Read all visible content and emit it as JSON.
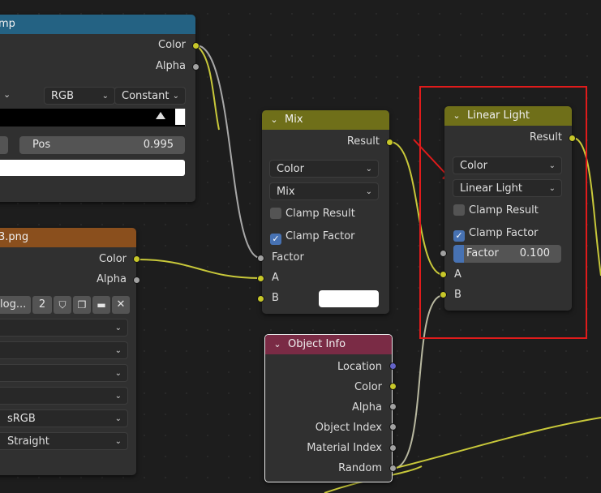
{
  "colorramp_node": {
    "title_fragment": "mp",
    "outputs": [
      "Color",
      "Alpha"
    ],
    "color_mode": "RGB",
    "interpolation": "Constant",
    "pos_label": "Pos",
    "pos_value": "0.995"
  },
  "image_node": {
    "title_fragment": "3.png",
    "outputs": [
      "Color",
      "Alpha"
    ],
    "image_name_fragment": "log...",
    "user_count": "2",
    "color_space": "sRGB",
    "alpha_mode": "Straight"
  },
  "mix_node": {
    "title": "Mix",
    "output": "Result",
    "data_type": "Color",
    "blend_mode": "Mix",
    "clamp_result_label": "Clamp Result",
    "clamp_result": false,
    "clamp_factor_label": "Clamp Factor",
    "clamp_factor": true,
    "inputs": [
      "Factor",
      "A",
      "B"
    ]
  },
  "linear_light_node": {
    "title": "Linear Light",
    "output": "Result",
    "data_type": "Color",
    "blend_mode": "Linear Light",
    "clamp_result_label": "Clamp Result",
    "clamp_result": false,
    "clamp_factor_label": "Clamp Factor",
    "clamp_factor": true,
    "factor_label": "Factor",
    "factor_value": "0.100",
    "factor_fraction": 0.1,
    "inputs": [
      "A",
      "B"
    ]
  },
  "object_info_node": {
    "title": "Object Info",
    "outputs": [
      "Location",
      "Color",
      "Alpha",
      "Object Index",
      "Material Index",
      "Random"
    ]
  },
  "colors": {
    "background": "#1d1d1d",
    "node_body": "#303030",
    "colorramp_header": "#246283",
    "image_header": "#8a4f1d",
    "mix_header": "#6f6f19",
    "object_info_header": "#7a2b45",
    "socket_color": "#c7c729",
    "socket_float": "#a1a1a1",
    "socket_vector": "#6363c7",
    "checkbox_on": "#4772b3",
    "annotation": "#e01b1b"
  }
}
